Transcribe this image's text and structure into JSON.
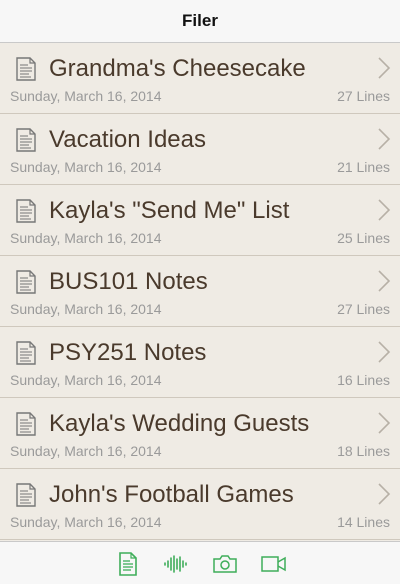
{
  "nav": {
    "title": "Filer"
  },
  "files": [
    {
      "title": "Grandma's Cheesecake",
      "date": "Sunday, March 16, 2014",
      "lines": "27 Lines"
    },
    {
      "title": "Vacation Ideas",
      "date": "Sunday, March 16, 2014",
      "lines": "21 Lines"
    },
    {
      "title": "Kayla's \"Send Me\" List",
      "date": "Sunday, March 16, 2014",
      "lines": "25 Lines"
    },
    {
      "title": "BUS101 Notes",
      "date": "Sunday, March 16, 2014",
      "lines": "27 Lines"
    },
    {
      "title": "PSY251 Notes",
      "date": "Sunday, March 16, 2014",
      "lines": "16 Lines"
    },
    {
      "title": "Kayla's Wedding Guests",
      "date": "Sunday, March 16, 2014",
      "lines": "18 Lines"
    },
    {
      "title": "John's Football Games",
      "date": "Sunday, March 16, 2014",
      "lines": "14 Lines"
    }
  ],
  "tabbar": {
    "tabs": [
      {
        "icon": "document-icon",
        "selected": true
      },
      {
        "icon": "audio-wave-icon",
        "selected": false
      },
      {
        "icon": "camera-icon",
        "selected": false
      },
      {
        "icon": "video-camera-icon",
        "selected": false
      }
    ],
    "accent_color": "#3fae5a"
  },
  "colors": {
    "background": "#efebe4",
    "title_text": "#4a3a2c",
    "meta_text": "#9a9a9a"
  }
}
